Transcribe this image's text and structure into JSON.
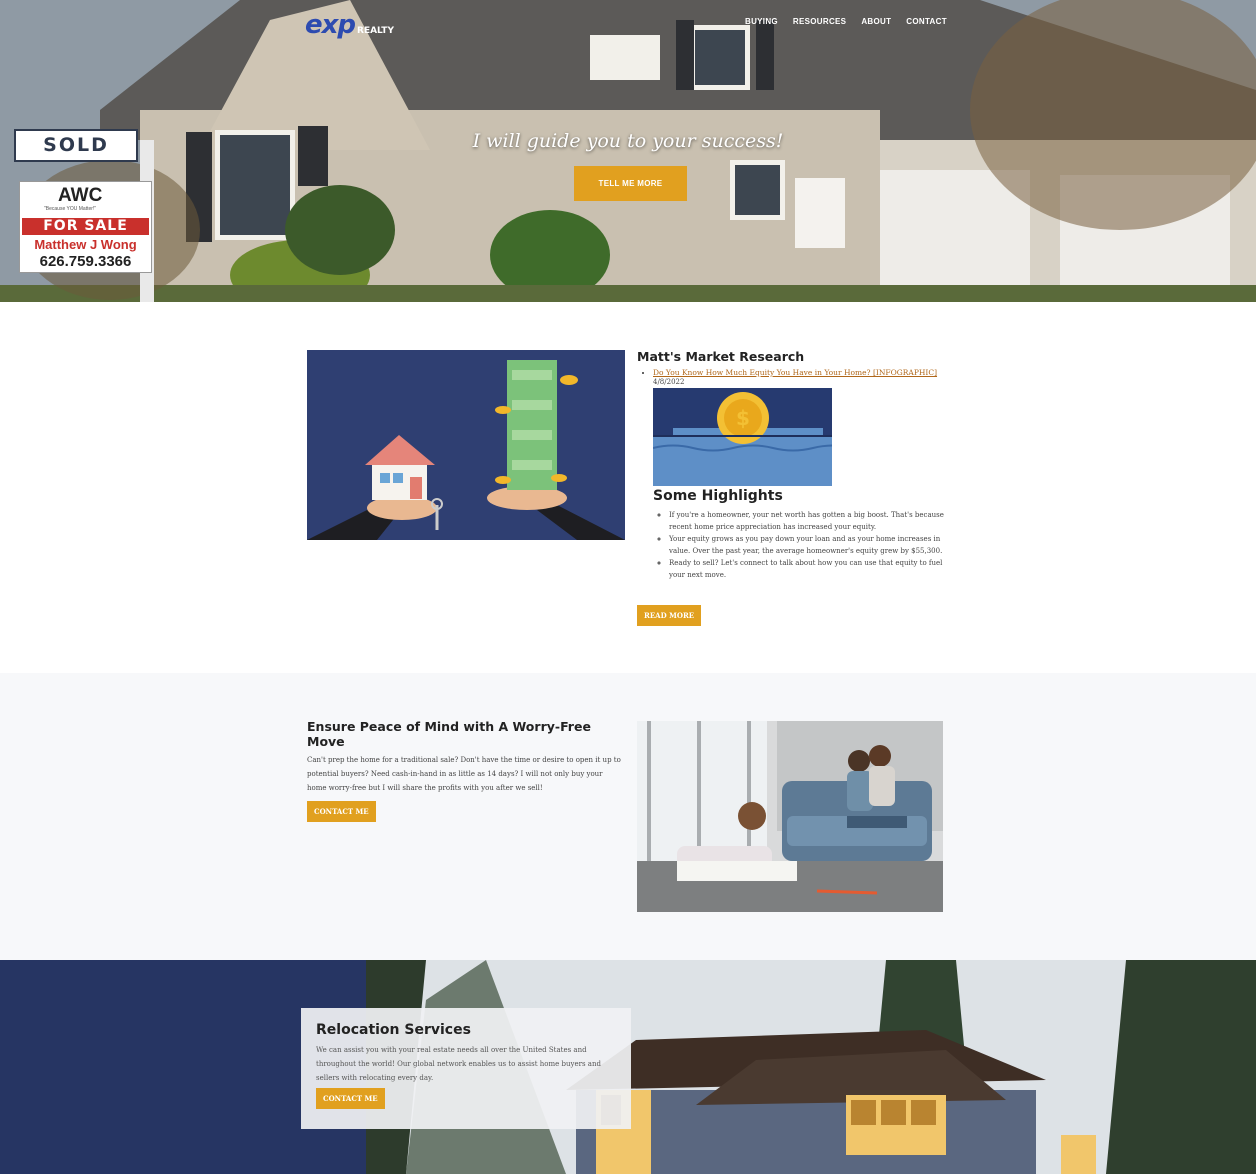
{
  "header": {
    "logo": "exp",
    "logo_sub": "REALTY",
    "nav": [
      "BUYING",
      "RESOURCES",
      "ABOUT",
      "CONTACT"
    ]
  },
  "hero": {
    "title": "I will guide you to your success!",
    "button": "TELL ME MORE",
    "sign": {
      "sold": "SOLD",
      "brand": "AWC",
      "tagline": "\"Because YOU Matter!\"",
      "for_sale": "FOR SALE",
      "agent": "Matthew J Wong",
      "phone": "626.759.3366"
    }
  },
  "market": {
    "title": "Matt's Market Research",
    "post_link": "Do You Know How Much Equity You Have in Your Home? [INFOGRAPHIC]",
    "post_date": "4/8/2022",
    "highlights_title": "Some Highlights",
    "highlights": [
      "If you're a homeowner, your net worth has gotten a big boost. That's because recent home price appreciation has increased your equity.",
      "Your equity grows as you pay down your loan and as your home increases in value. Over the past year, the average homeowner's equity grew by $55,300.",
      "Ready to sell? Let's connect to talk about how you can use that equity to fuel your next move."
    ],
    "read_more": "READ MORE"
  },
  "worry": {
    "title": "Ensure Peace of Mind with A Worry-Free Move",
    "text": "Can't prep the home for a traditional sale? Don't have the time or desire to open it up to potential buyers? Need cash-in-hand in as little as 14 days? I will not only buy your home worry-free but I will share the profits with you after we sell!",
    "button": "CONTACT ME"
  },
  "relocation": {
    "title": "Relocation Services",
    "text": "We can assist you with your real estate needs all over the United States and throughout the world! Our global network enables us to assist home buyers and sellers with relocating every day.",
    "button": "CONTACT ME"
  },
  "colors": {
    "accent": "#e1a01f",
    "navy": "#263563",
    "link": "#b0671a"
  }
}
